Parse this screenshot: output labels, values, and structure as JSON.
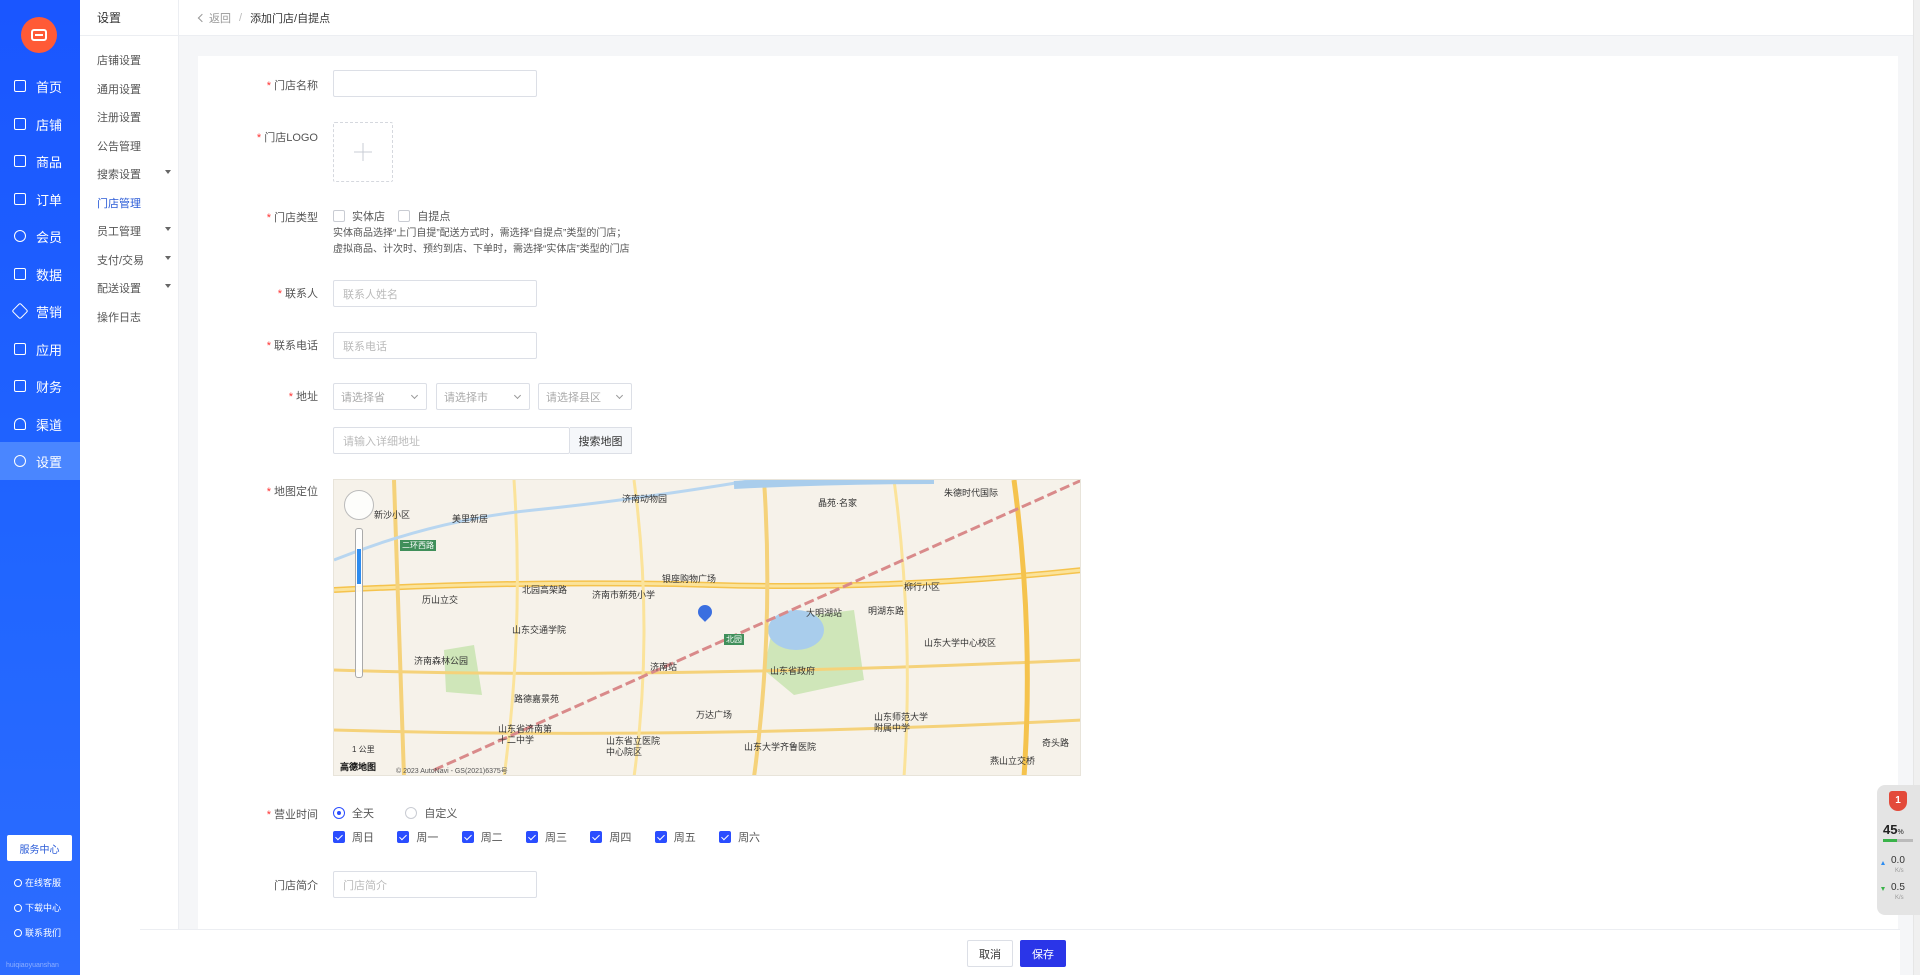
{
  "sidebar": {
    "items": [
      {
        "label": "首页",
        "icon": "home-icon"
      },
      {
        "label": "店铺",
        "icon": "shop-icon"
      },
      {
        "label": "商品",
        "icon": "goods-icon"
      },
      {
        "label": "订单",
        "icon": "order-icon"
      },
      {
        "label": "会员",
        "icon": "member-icon"
      },
      {
        "label": "数据",
        "icon": "data-icon"
      },
      {
        "label": "营销",
        "icon": "tag-icon"
      },
      {
        "label": "应用",
        "icon": "app-icon"
      },
      {
        "label": "财务",
        "icon": "finance-icon"
      },
      {
        "label": "渠道",
        "icon": "channel-icon"
      },
      {
        "label": "设置",
        "icon": "settings-icon"
      }
    ],
    "active": "设置",
    "service_center": "服务中心",
    "footer": [
      "在线客服",
      "下载中心",
      "联系我们"
    ],
    "brand": "huiqiaoyuanshan"
  },
  "submenu": {
    "title": "设置",
    "items": [
      "店铺设置",
      "通用设置",
      "注册设置",
      "公告管理",
      "搜索设置",
      "门店管理",
      "员工管理",
      "支付/交易",
      "配送设置",
      "操作日志"
    ],
    "active": "门店管理"
  },
  "breadcrumb": {
    "back": "返回",
    "separator": "/",
    "current": "添加门店/自提点"
  },
  "form": {
    "store_name": {
      "label": "门店名称",
      "value": ""
    },
    "logo": {
      "label": "门店LOGO"
    },
    "store_type": {
      "label": "门店类型",
      "options": [
        "实体店",
        "自提点"
      ],
      "hint1": "实体商品选择“上门自提”配送方式时，需选择“自提点”类型的门店；",
      "hint2": "虚拟商品、计次时、预约到店、下单时，需选择“实体店”类型的门店"
    },
    "contact": {
      "label": "联系人",
      "placeholder": "联系人姓名"
    },
    "phone": {
      "label": "联系电话",
      "placeholder": "联系电话"
    },
    "address": {
      "label": "地址",
      "province": "请选择省",
      "city": "请选择市",
      "district": "请选择县区",
      "detail_placeholder": "请输入详细地址",
      "search_button": "搜索地图"
    },
    "map": {
      "label": "地图定位",
      "places": [
        "济南动物园",
        "新沙小区",
        "美里新居",
        "二环西路",
        "北园高架路",
        "济南市新苑小学",
        "银座购物广场",
        "大明湖站",
        "柳行小区",
        "山东交通学院",
        "济南森林公园",
        "济南站",
        "北园",
        "山东省政府",
        "山东大学中心校区",
        "路德嘉景苑",
        "万达广场",
        "山东省济南第十二中学",
        "山东省立医院中心院区",
        "山东大学齐鲁医院",
        "山东师范大学附属中学",
        "燕山立交桥",
        "历山立交",
        "晶苑·名家",
        "朱德时代国际",
        "奇头路",
        "明湖东路"
      ],
      "scale": "1 公里",
      "logo": "高德地图",
      "copyright": "© 2023 AutoNavi - GS(2021)6375号"
    },
    "hours": {
      "label": "营业时间",
      "modes": [
        "全天",
        "自定义"
      ],
      "selected_mode": "全天",
      "days": [
        "周日",
        "周一",
        "周二",
        "周三",
        "周四",
        "周五",
        "周六"
      ]
    },
    "intro": {
      "label": "门店简介",
      "placeholder": "门店简介"
    }
  },
  "actions": {
    "cancel": "取消",
    "save": "保存"
  },
  "widget": {
    "badge": "1",
    "percent": "45",
    "percent_unit": "%",
    "up": "0.0",
    "down": "0.5",
    "unit": "K/s"
  },
  "colors": {
    "primary": "#2a35e8",
    "sidebar": "#1f5dff",
    "required": "#ff3333"
  }
}
